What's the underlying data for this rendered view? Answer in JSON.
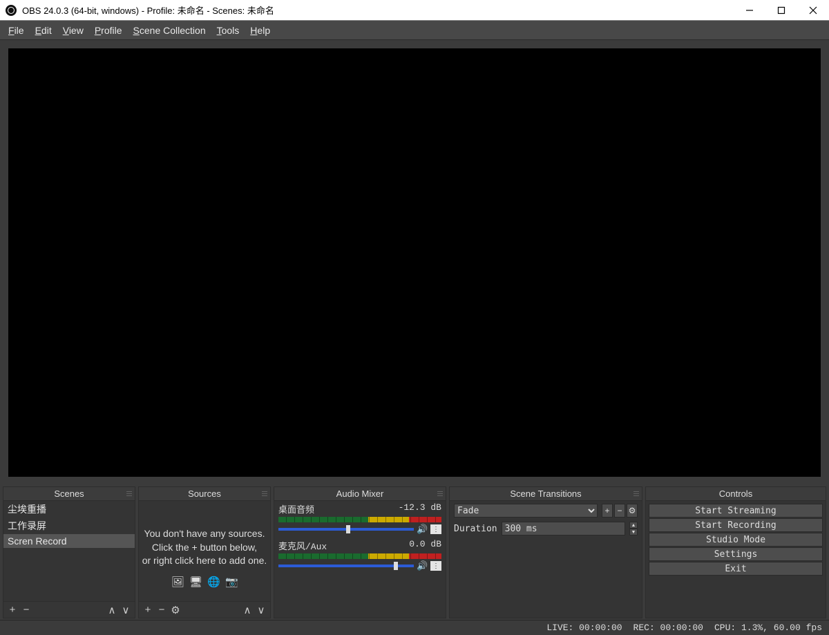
{
  "window": {
    "title": "OBS 24.0.3 (64-bit, windows) - Profile: 未命名 - Scenes: 未命名"
  },
  "menubar": {
    "file": "File",
    "edit": "Edit",
    "view": "View",
    "profile": "Profile",
    "scene_collection": "Scene Collection",
    "tools": "Tools",
    "help": "Help"
  },
  "docks": {
    "scenes": {
      "title": "Scenes",
      "items": [
        "尘埃重播",
        "工作录屏",
        "Scren Record"
      ],
      "selected_index": 2
    },
    "sources": {
      "title": "Sources",
      "empty_msg_l1": "You don't have any sources.",
      "empty_msg_l2": "Click the + button below,",
      "empty_msg_l3": "or right click here to add one."
    },
    "mixer": {
      "title": "Audio Mixer",
      "tracks": [
        {
          "name": "桌面音频",
          "db": "-12.3 dB",
          "slider_pct": 50
        },
        {
          "name": "麦克风/Aux",
          "db": "0.0 dB",
          "slider_pct": 85
        }
      ]
    },
    "transitions": {
      "title": "Scene Transitions",
      "selected": "Fade",
      "duration_label": "Duration",
      "duration_value": "300 ms"
    },
    "controls": {
      "title": "Controls",
      "buttons": [
        "Start Streaming",
        "Start Recording",
        "Studio Mode",
        "Settings",
        "Exit"
      ]
    }
  },
  "statusbar": {
    "live": "LIVE: 00:00:00",
    "rec": "REC: 00:00:00",
    "cpu": "CPU: 1.3%, 60.00 fps"
  }
}
